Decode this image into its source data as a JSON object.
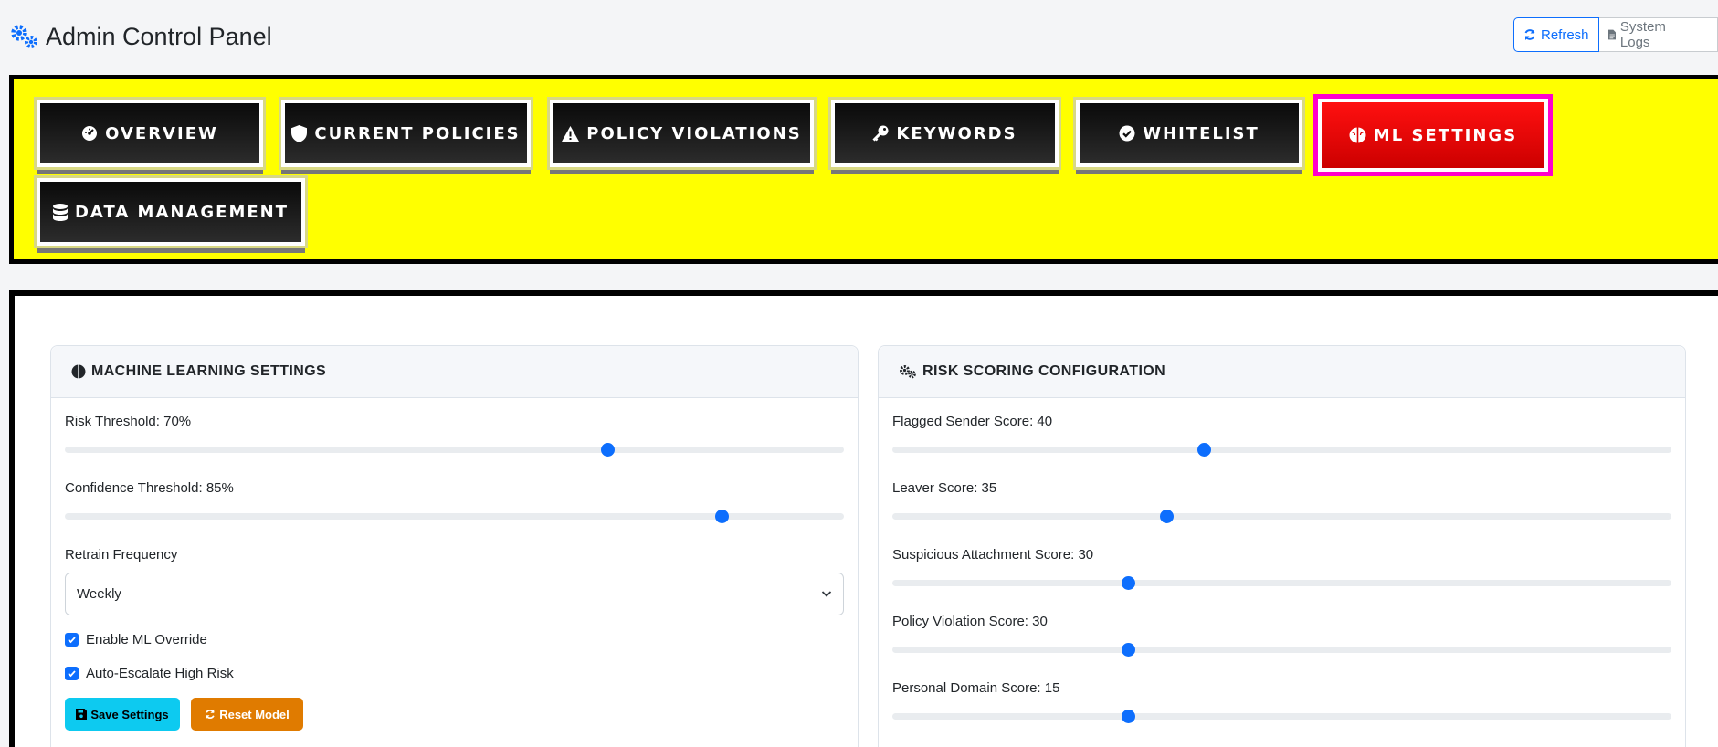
{
  "header": {
    "title": "Admin Control Panel",
    "refresh_label": "Refresh",
    "logs_label": "System Logs"
  },
  "tabs": [
    {
      "label": "OVERVIEW",
      "icon": "gauge-icon",
      "active": false
    },
    {
      "label": "CURRENT POLICIES",
      "icon": "shield-icon",
      "active": false
    },
    {
      "label": "POLICY VIOLATIONS",
      "icon": "warning-icon",
      "active": false
    },
    {
      "label": "KEYWORDS",
      "icon": "key-icon",
      "active": false
    },
    {
      "label": "WHITELIST",
      "icon": "check-circle-icon",
      "active": false
    },
    {
      "label": "ML SETTINGS",
      "icon": "brain-icon",
      "active": true
    },
    {
      "label": "DATA MANAGEMENT",
      "icon": "database-icon",
      "active": false
    }
  ],
  "ml_settings": {
    "title": "MACHINE LEARNING SETTINGS",
    "risk_threshold_label": "Risk Threshold: 70%",
    "risk_threshold_value": 70,
    "confidence_threshold_label": "Confidence Threshold: 85%",
    "confidence_threshold_value": 85,
    "retrain_label": "Retrain Frequency",
    "retrain_value": "Weekly",
    "ml_override_label": "Enable ML Override",
    "ml_override_checked": true,
    "auto_escalate_label": "Auto-Escalate High Risk",
    "auto_escalate_checked": true,
    "save_label": "Save Settings",
    "reset_label": "Reset Model"
  },
  "risk_scoring": {
    "title": "RISK SCORING CONFIGURATION",
    "sliders": [
      {
        "label": "Flagged Sender Score: 40",
        "value": 40
      },
      {
        "label": "Leaver Score: 35",
        "value": 35
      },
      {
        "label": "Suspicious Attachment Score: 30",
        "value": 30
      },
      {
        "label": "Policy Violation Score: 30",
        "value": 30
      },
      {
        "label": "Personal Domain Score: 15",
        "value": 15
      }
    ]
  },
  "colors": {
    "accent": "#0d6efd",
    "tab_panel_bg": "#ffff00",
    "active_tab": "#ff0000",
    "active_outline": "#ff00cc",
    "save_button": "#0dcaf0",
    "reset_button": "#e07b00"
  }
}
